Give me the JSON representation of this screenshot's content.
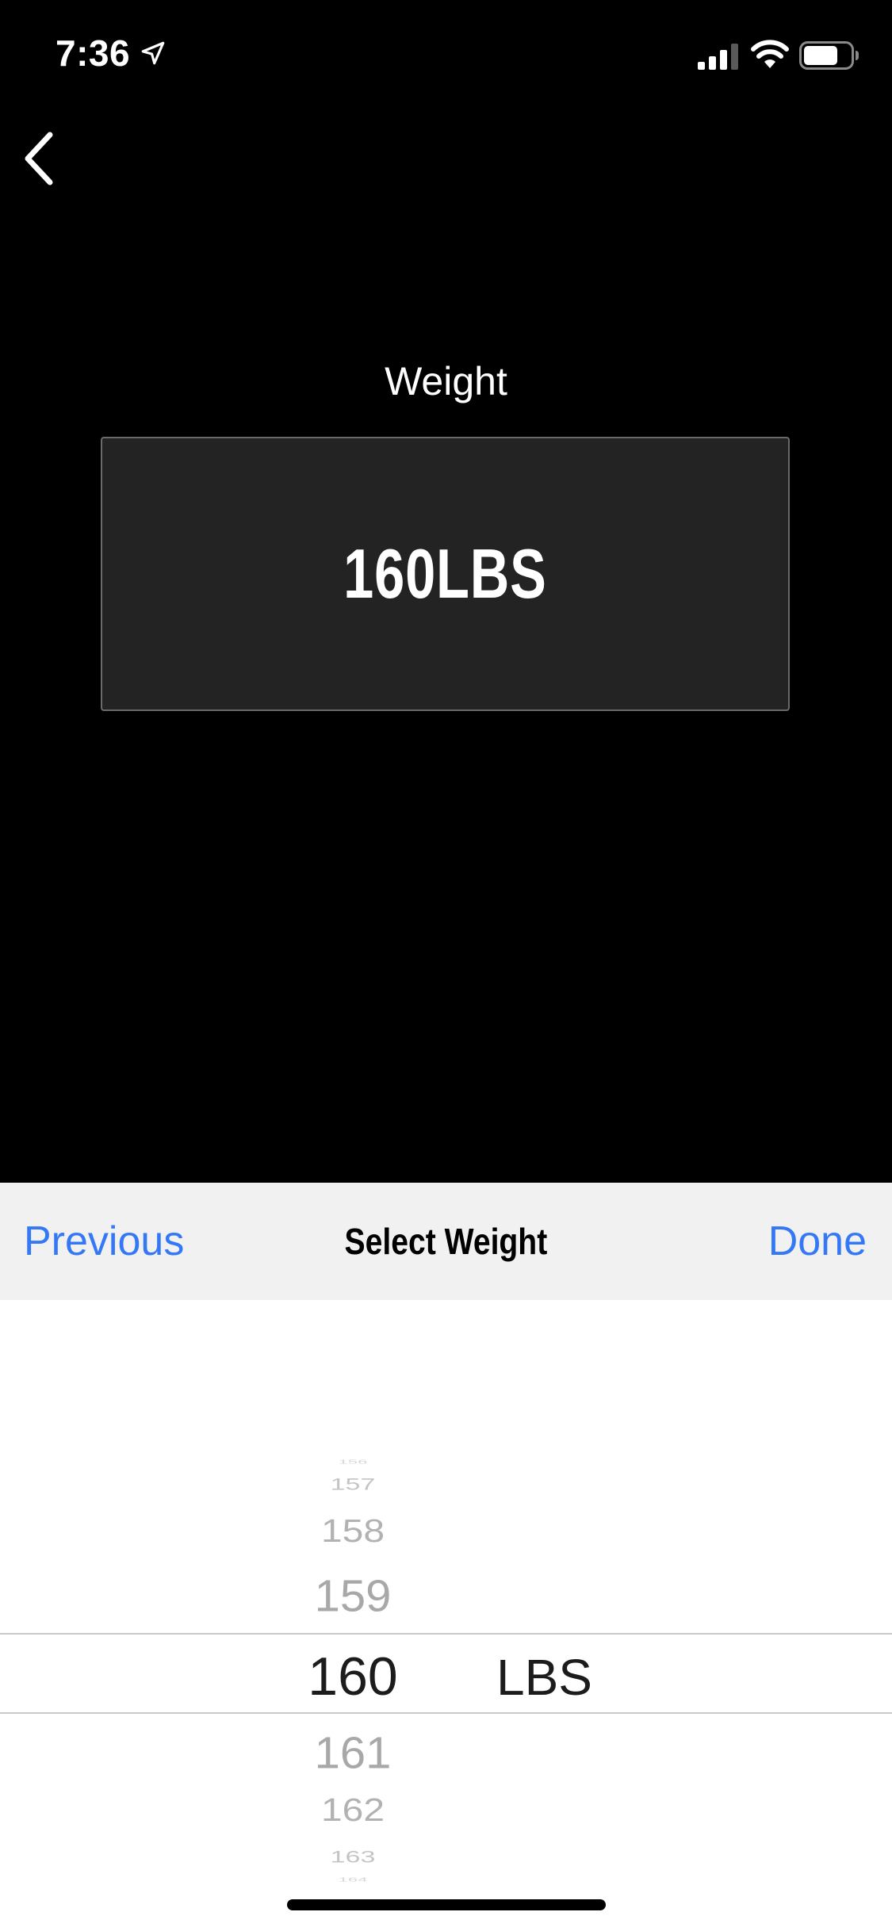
{
  "status_bar": {
    "time": "7:36",
    "icons": [
      "location-arrow-icon",
      "cellular-signal-icon",
      "wifi-icon",
      "battery-icon"
    ]
  },
  "nav": {
    "back_icon": "chevron-left-icon"
  },
  "field": {
    "label": "Weight",
    "value": "160LBS"
  },
  "picker": {
    "previous_label": "Previous",
    "title": "Select Weight",
    "done_label": "Done",
    "values": [
      "156",
      "157",
      "158",
      "159",
      "160",
      "161",
      "162",
      "163",
      "164"
    ],
    "selected_value": "160",
    "unit": "LBS"
  },
  "colors": {
    "background": "#000000",
    "field_background": "#232323",
    "accent": "#3478f6",
    "toolbar_background": "#f1f1f1",
    "picker_background": "#ffffff"
  }
}
